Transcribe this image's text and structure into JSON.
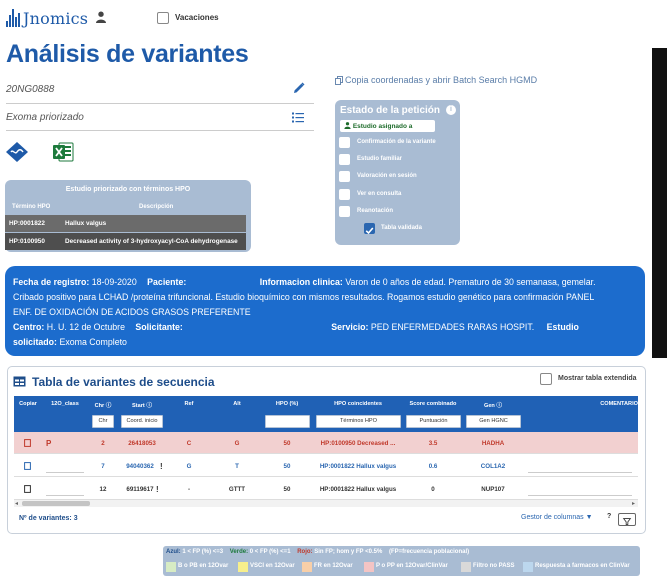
{
  "app": {
    "logo": "Jnomics"
  },
  "header": {
    "vacaciones_label": "Vacaciones"
  },
  "page": {
    "title": "Análisis de variantes"
  },
  "sample": {
    "id": "20NG0888",
    "analysis_type": "Exoma priorizado"
  },
  "copy_link": "Copia coordenadas y abrir Batch Search HGMD",
  "hpo_table": {
    "title": "Estudio priorizado con términos HPO",
    "col_term": "Término HPO",
    "col_desc": "Descripción",
    "rows": [
      {
        "term": "HP:0001822",
        "desc": "Hallux valgus"
      },
      {
        "term": "HP:0100950",
        "desc": "Decreased activity of 3-hydroxyacyl-CoA dehydrogenase"
      }
    ]
  },
  "estado": {
    "title": "Estado de la petición",
    "badge": "Estudio asignado a",
    "items": [
      "Confirmación de la variante",
      "Estudio familiar",
      "Valoración en sesión",
      "Ver en consulta",
      "Reanotación",
      "Tabla validada"
    ]
  },
  "info": {
    "fecha_label": "Fecha de registro:",
    "fecha": "18-09-2020",
    "paciente_label": "Paciente:",
    "clinica_label": "Informacion clinica:",
    "clinica_1": "Varon de 0 años de edad. Prematuro de 30 semanasa, gemelar.",
    "clinica_2": "Cribado positivo para LCHAD /proteína trifuncional. Estudio bioquímico con mismos resultados. Rogamos estudio genético para confirmación PANEL",
    "clinica_3": "ENF. DE OXIDACIÓN DE ACIDOS GRASOS PREFERENTE",
    "centro_label": "Centro:",
    "centro": "H. U. 12 de Octubre",
    "solicitante_label": "Solicitante:",
    "servicio_label": "Servicio:",
    "servicio": "PED ENFERMEDADES RARAS HOSPIT.",
    "estudio_label_1": "Estudio",
    "estudio_label_2": "solicitado:",
    "estudio": "Exoma Completo"
  },
  "variants": {
    "title": "Tabla de variantes de secuencia",
    "extended_label": "Mostrar tabla extendida",
    "columns": [
      "Copiar",
      "12O_class",
      "Chr",
      "Start",
      "Ref",
      "Alt",
      "HPO (%)",
      "HPO coincidentes",
      "Score combinado",
      "Gen",
      "COMENTARIO"
    ],
    "filters": {
      "chr": "Chr",
      "start": "Coord. inicio",
      "hpo": "Términos HPO",
      "score": "Puntuación",
      "gen": "Gen HGNC"
    },
    "rows": [
      {
        "class": "P",
        "chr": "2",
        "start": "26418053",
        "ref": "C",
        "alt": "G",
        "hpo_pct": "50",
        "hpo_match": "HP:0100950 Decreased ...",
        "score": "3.5",
        "gene": "HADHA"
      },
      {
        "class": "",
        "chr": "7",
        "start": "94040362",
        "ref": "G",
        "alt": "T",
        "hpo_pct": "50",
        "hpo_match": "HP:0001822 Hallux valgus",
        "score": "0.6",
        "gene": "COL1A2"
      },
      {
        "class": "",
        "chr": "12",
        "start": "69119617",
        "ref": "-",
        "alt": "GTTT",
        "hpo_pct": "50",
        "hpo_match": "HP:0001822 Hallux valgus",
        "score": "0",
        "gene": "NUP107"
      }
    ],
    "count_label": "Nº de variantes: 3",
    "column_manager": "Gestor de columnas ▼",
    "help": "?"
  },
  "legend": {
    "azul": "Azul:",
    "azul_text": "1 < FP (%) <=3",
    "verde": "Verde:",
    "verde_text": "0 < FP (%) <=1",
    "rojo": "Rojo:",
    "rojo_text": "Sin FP; hom y FP <0.5%",
    "fp_note": "(FP=frecuencia poblacional)",
    "items": [
      "B o PB en 12Ovar",
      "VSCI en 12Ovar",
      "FR en 12Ovar",
      "P o PP en 12Ovar/ClinVar",
      "Filtro no PASS",
      "Respuesta a farmacos en ClinVar"
    ],
    "colors": [
      "#d7ecc4",
      "#f7ef8c",
      "#f8cfa8",
      "#f4c4c4",
      "#d9d9d9",
      "#bcd7ee"
    ]
  }
}
